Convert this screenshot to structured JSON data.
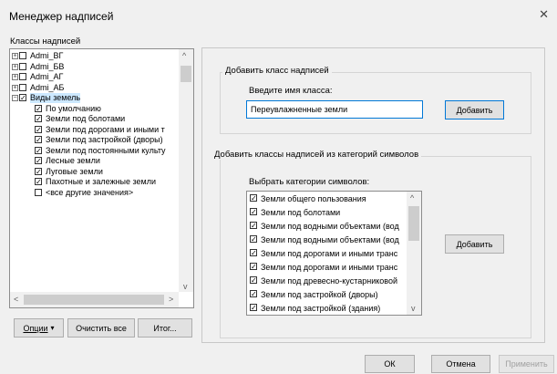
{
  "window": {
    "title": "Менеджер надписей",
    "close_glyph": "✕"
  },
  "left": {
    "group_label": "Классы надписей",
    "tree": [
      {
        "label": "Admi_ВГ",
        "checked": false,
        "indent": 0,
        "expander": "+"
      },
      {
        "label": "Admi_БВ",
        "checked": false,
        "indent": 0,
        "expander": "+"
      },
      {
        "label": "Admi_АГ",
        "checked": false,
        "indent": 0,
        "expander": "+"
      },
      {
        "label": "Admi_АБ",
        "checked": false,
        "indent": 0,
        "expander": "+"
      },
      {
        "label": "Виды земель",
        "checked": true,
        "indent": 0,
        "expander": "−",
        "selected": true
      },
      {
        "label": "По умолчанию",
        "checked": true,
        "indent": 1
      },
      {
        "label": "Земли под болотами",
        "checked": true,
        "indent": 1
      },
      {
        "label": "Земли под дорогами и иными т",
        "checked": true,
        "indent": 1
      },
      {
        "label": "Земли под застройкой (дворы)",
        "checked": true,
        "indent": 1
      },
      {
        "label": "Земли под постоянными культу",
        "checked": true,
        "indent": 1
      },
      {
        "label": "Лесные земли",
        "checked": true,
        "indent": 1
      },
      {
        "label": "Луговые земли",
        "checked": true,
        "indent": 1
      },
      {
        "label": "Пахотные и залежные земли",
        "checked": true,
        "indent": 1
      },
      {
        "label": "<все другие значения>",
        "checked": false,
        "indent": 1
      }
    ],
    "scroll_up": "^",
    "scroll_down": "v",
    "scroll_left": "<",
    "scroll_right": ">",
    "buttons": {
      "options": "Опции",
      "options_arrow": "▾",
      "clear_all": "Очистить все",
      "summary": "Итог..."
    }
  },
  "add_class": {
    "legend": "Добавить класс надписей",
    "prompt": "Введите имя класса:",
    "input_value": "Переувлажненные земли",
    "add_button": "Добавить"
  },
  "add_from_categories": {
    "legend": "Добавить классы надписей из категорий символов",
    "prompt": "Выбрать категории символов:",
    "items": [
      {
        "label": "Земли общего пользования",
        "checked": true
      },
      {
        "label": "Земли под болотами",
        "checked": true
      },
      {
        "label": "Земли под водными объектами (вод",
        "checked": true
      },
      {
        "label": "Земли под водными объектами (вод",
        "checked": true
      },
      {
        "label": "Земли под дорогами и иными транс",
        "checked": true
      },
      {
        "label": "Земли под дорогами и иными транс",
        "checked": true
      },
      {
        "label": "Земли под древесно-кустарниковой",
        "checked": true
      },
      {
        "label": "Земли под застройкой (дворы)",
        "checked": true
      },
      {
        "label": "Земли под застройкой (здания)",
        "checked": true
      }
    ],
    "scroll_up": "^",
    "scroll_down": "v",
    "add_button": "Добавить"
  },
  "footer": {
    "ok": "ОК",
    "cancel": "Отмена",
    "apply": "Применить"
  }
}
